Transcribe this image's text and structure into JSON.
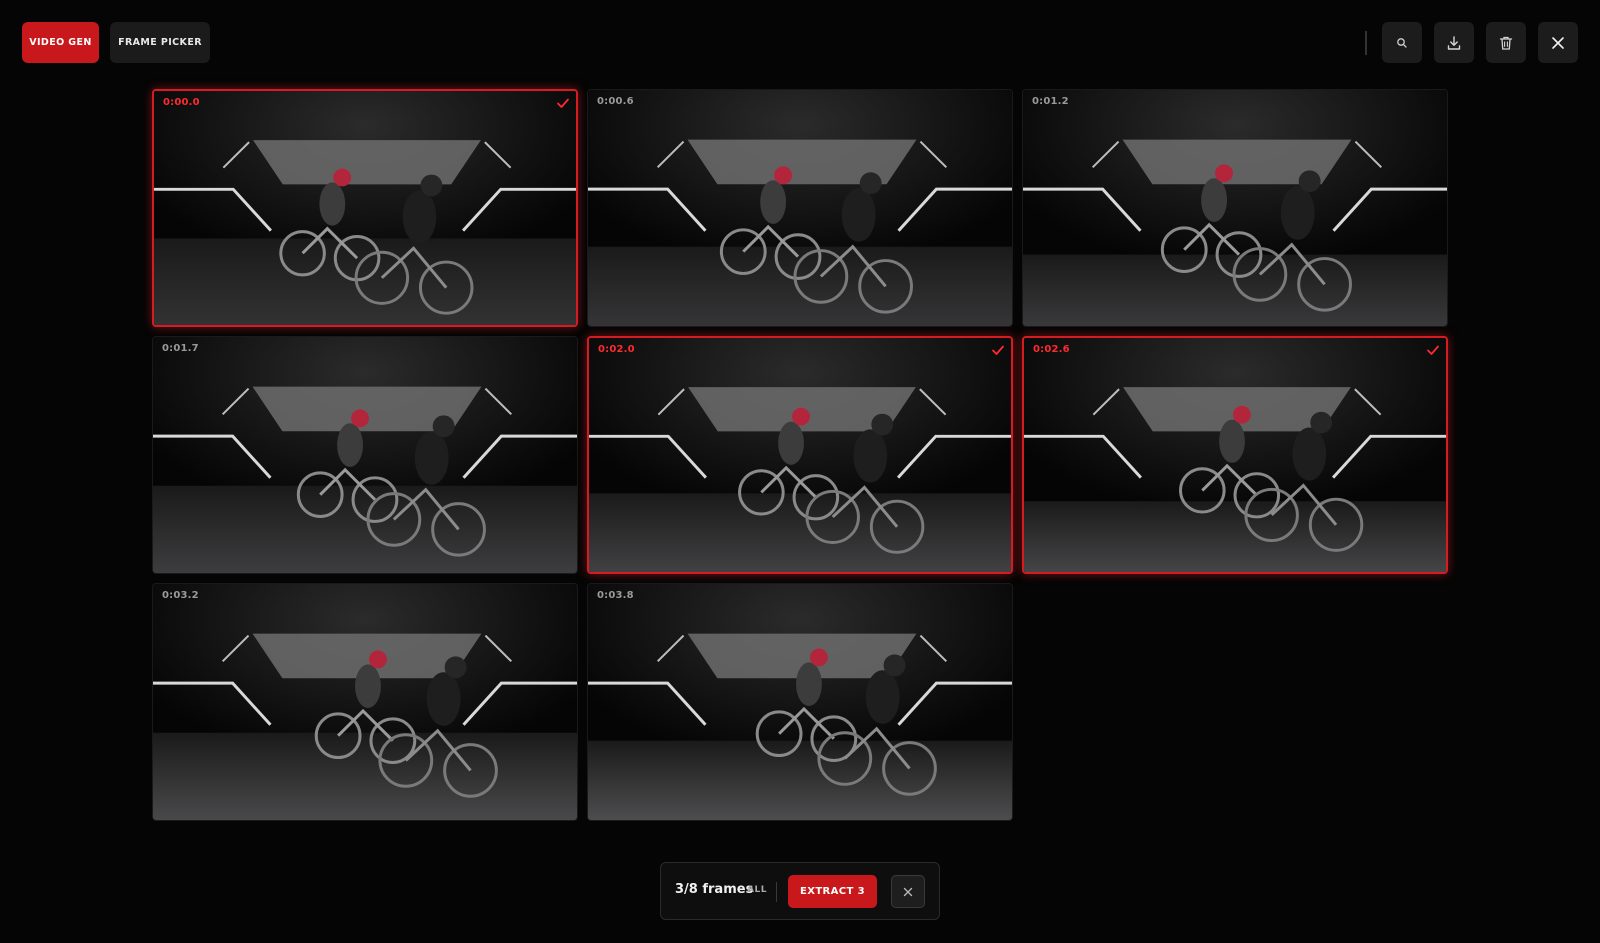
{
  "toolbar": {
    "tabs": [
      {
        "label": "VIDEO GEN",
        "active": true
      },
      {
        "label": "FRAME PICKER",
        "active": false
      }
    ],
    "actions": [
      "search-icon",
      "download-icon",
      "trash-icon",
      "close-icon"
    ]
  },
  "frames": [
    {
      "timestamp": "0:00.0",
      "selected": true
    },
    {
      "timestamp": "0:00.6",
      "selected": false
    },
    {
      "timestamp": "0:01.2",
      "selected": false
    },
    {
      "timestamp": "0:01.7",
      "selected": false
    },
    {
      "timestamp": "0:02.0",
      "selected": true
    },
    {
      "timestamp": "0:02.6",
      "selected": true
    },
    {
      "timestamp": "0:03.2",
      "selected": false
    },
    {
      "timestamp": "0:03.8",
      "selected": false
    }
  ],
  "footer": {
    "count_label": "3/8 frames",
    "all_label": "ALL",
    "extract_label": "EXTRACT 3"
  },
  "colors": {
    "accent": "#c8181c",
    "background": "#050505",
    "selected_border": "#d31d22"
  }
}
